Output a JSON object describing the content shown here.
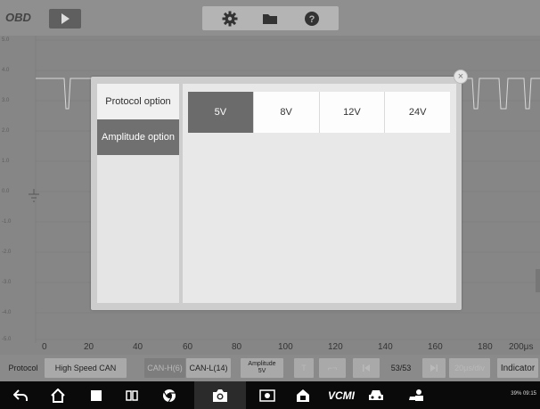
{
  "toolbar": {
    "logo_text": "OBD",
    "icons": [
      "play-icon",
      "gear-icon",
      "folder-icon",
      "help-icon"
    ]
  },
  "scope": {
    "y_labels": [
      "5.0",
      "4.0",
      "3.0",
      "2.0",
      "1.0",
      "0.0",
      "-1.0",
      "-2.0",
      "-3.0",
      "-4.0",
      "-5.0"
    ],
    "x_labels": [
      "0",
      "20",
      "40",
      "60",
      "80",
      "100",
      "120",
      "140",
      "160",
      "180",
      "200μs"
    ]
  },
  "controls": {
    "protocol_label": "Protocol",
    "protocol_value": "High Speed CAN",
    "can_h": "CAN-H(6)",
    "can_l": "CAN-L(14)",
    "amplitude_line1": "Amplitude",
    "amplitude_line2": "5V",
    "t_label": "T",
    "trigger_symbol": "⌐¬",
    "page_counter": "53/53",
    "time_per_div": "20μs/div",
    "indicator_label": "Indicator"
  },
  "modal": {
    "side_items": [
      "Protocol option",
      "Amplitude option"
    ],
    "selected_side_item": "Amplitude option",
    "amplitude_options": [
      "5V",
      "8V",
      "12V",
      "24V"
    ],
    "selected_amplitude": "5V",
    "close_symbol": "×"
  },
  "navbar": {
    "vcm_label": "VCMI",
    "status_text": "39% 09:15",
    "icons": [
      "back-icon",
      "home-icon",
      "recent-apps-icon",
      "split-screen-icon",
      "chrome-icon",
      "camera-icon",
      "screen-record-icon",
      "maxifix-icon",
      "vcmi-icon",
      "car-icon",
      "user-car-icon"
    ]
  },
  "colors": {
    "active_option": "#6b6b6b",
    "modal_bg": "#cdcdcd",
    "scope_bg": "#868686"
  }
}
